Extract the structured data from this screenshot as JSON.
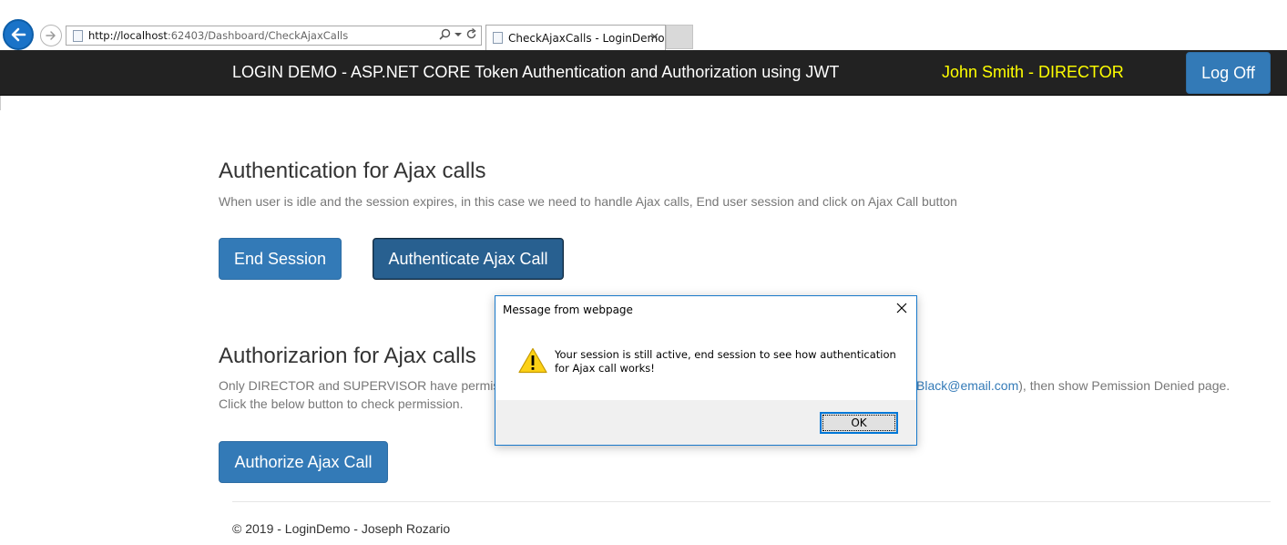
{
  "browser": {
    "url_host": "http://localhost",
    "url_rest": ":62403/Dashboard/CheckAjaxCalls",
    "tab_title": "CheckAjaxCalls - LoginDemo",
    "tab_close": "✕"
  },
  "navbar": {
    "brand": "LOGIN DEMO - ASP.NET CORE Token Authentication and Authorization using JWT",
    "user": "John Smith - DIRECTOR",
    "logoff_label": "Log Off"
  },
  "authentication": {
    "heading": "Authentication for Ajax calls",
    "description": "When user is idle and the session expires, in this case we need to handle Ajax calls, End user session and click on Ajax Call button",
    "end_session_label": "End Session",
    "authenticate_label": "Authenticate Ajax Call"
  },
  "authorization": {
    "heading": "Authorizarion for Ajax calls",
    "desc_line1_start": "Only DIRECTOR and SUPERVISOR have permis",
    "desc_line1_link": "Black@email.com",
    "desc_line1_end": "), then show Pemission Denied page.",
    "desc_line2": "Click the below button to check permission.",
    "authorize_label": "Authorize Ajax Call"
  },
  "footer": {
    "text": "© 2019 - LoginDemo - Joseph Rozario"
  },
  "dialog": {
    "title": "Message from webpage",
    "message": "Your session is still active, end session to see how authentication for Ajax call works!",
    "ok_label": "OK"
  },
  "colors": {
    "navbar_bg": "#222222",
    "user_label": "#ffff00",
    "primary": "#337ab7",
    "primary_active": "#286090",
    "dialog_border": "#1979ca"
  }
}
